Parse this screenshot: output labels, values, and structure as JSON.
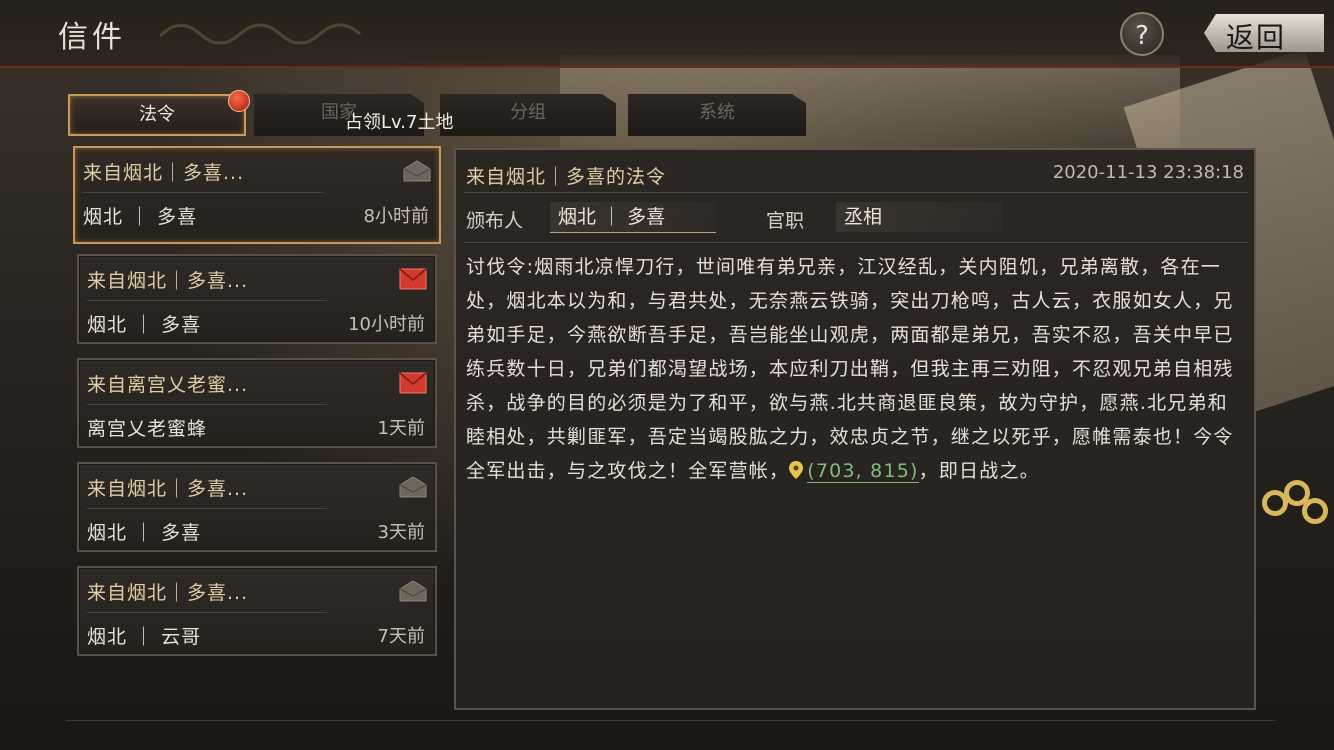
{
  "header": {
    "title": "信件",
    "help_label": "?",
    "back_label": "返回"
  },
  "tabs": [
    {
      "label": "法令",
      "active": true,
      "has_badge": true
    },
    {
      "label": "国家",
      "active": false
    },
    {
      "label": "分组",
      "active": false
    },
    {
      "label": "系统",
      "active": false
    }
  ],
  "tooltip": "占领Lv.7土地",
  "mail_list": [
    {
      "subject": "来自烟北｜多喜...",
      "sender": "烟北 ｜ 多喜",
      "time": "8小时前",
      "icon": "envelope-open-icon",
      "selected": true
    },
    {
      "subject": "来自烟北｜多喜...",
      "sender": "烟北 ｜ 多喜",
      "time": "10小时前",
      "icon": "envelope-unread-icon",
      "selected": false
    },
    {
      "subject": "来自离宫乂老蜜...",
      "sender": "离宫乂老蜜蜂",
      "time": "1天前",
      "icon": "envelope-unread-icon",
      "selected": false
    },
    {
      "subject": "来自烟北｜多喜...",
      "sender": "烟北 ｜ 多喜",
      "time": "3天前",
      "icon": "envelope-open-icon",
      "selected": false
    },
    {
      "subject": "来自烟北｜多喜...",
      "sender": "烟北 ｜ 云哥",
      "time": "7天前",
      "icon": "envelope-open-icon",
      "selected": false
    }
  ],
  "detail": {
    "subject": "来自烟北｜多喜的法令",
    "datetime": "2020-11-13 23:38:18",
    "publisher_label": "颁布人",
    "publisher_value": "烟北 ｜ 多喜",
    "office_label": "官职",
    "office_value": "丞相",
    "body_text": "讨伐令:烟雨北凉悍刀行，世间唯有弟兄亲，江汉经乱，关内阻饥，兄弟离散，各在一处，烟北本以为和，与君共处，无奈燕云铁骑，突出刀枪鸣，古人云，衣服如女人，兄弟如手足，今燕欲断吾手足，吾岂能坐山观虎，两面都是弟兄，吾实不忍，吾关中早已练兵数十日，兄弟们都渴望战场，本应利刀出鞘，但我主再三劝阻，不忍观兄弟自相残杀，战争的目的必须是为了和平，欲与燕.北共商退匪良策，故为守护，愿燕.北兄弟和睦相处，共剿匪军，吾定当竭股肱之力，效忠贞之节，继之以死乎，愿帷需泰也！今令全军出击，与之攻伐之！全军营帐，",
    "coordinate": "(703, 815)",
    "body_tail": "，即日战之。"
  },
  "colors": {
    "accent_gold": "#c8965a",
    "unread_red": "#d23a2e",
    "link_green": "#7fbf7d"
  }
}
